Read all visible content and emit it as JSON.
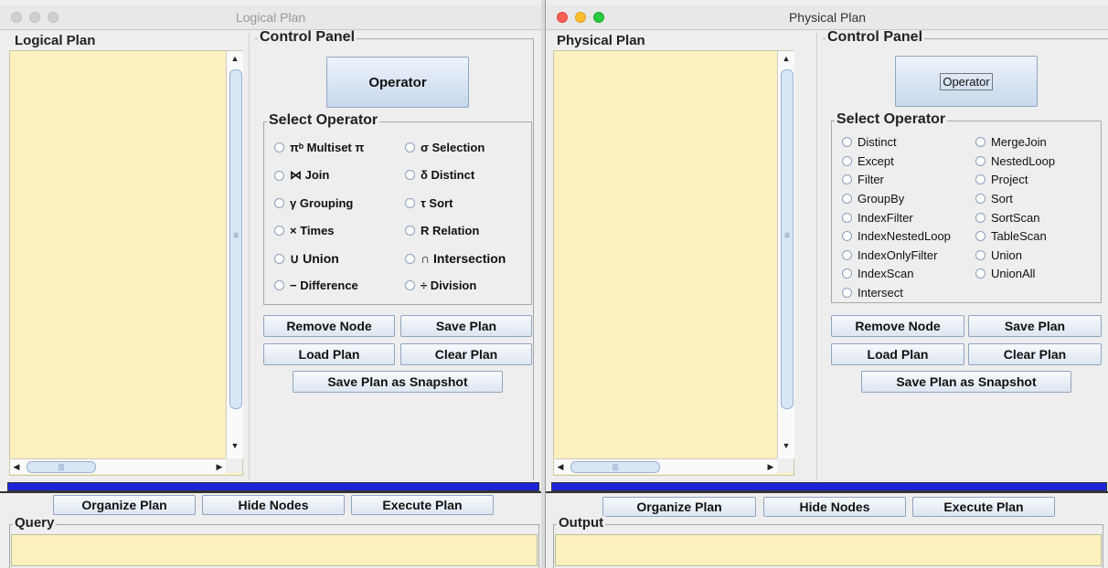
{
  "left": {
    "window_title": "Logical Plan",
    "plan_label": "Logical Plan",
    "control_panel_label": "Control Panel",
    "operator_button": "Operator",
    "select_operator_label": "Select Operator",
    "operators": [
      {
        "label": "πᵇ Multiset π"
      },
      {
        "label": "σ Selection"
      },
      {
        "label": "⋈ Join"
      },
      {
        "label": "δ Distinct"
      },
      {
        "label": "γ Grouping"
      },
      {
        "label": "τ Sort"
      },
      {
        "label": "× Times"
      },
      {
        "label": "R Relation"
      },
      {
        "label": "∪ Union"
      },
      {
        "label": "∩ Intersection"
      },
      {
        "label": "− Difference"
      },
      {
        "label": "÷ Division"
      }
    ],
    "buttons": {
      "remove_node": "Remove Node",
      "save_plan": "Save Plan",
      "load_plan": "Load Plan",
      "clear_plan": "Clear Plan",
      "save_snapshot": "Save Plan as Snapshot",
      "organize_plan": "Organize Plan",
      "hide_nodes": "Hide Nodes",
      "execute_plan": "Execute Plan"
    },
    "bottom_field_label": "Query"
  },
  "right": {
    "window_title": "Physical Plan",
    "plan_label": "Physical Plan",
    "control_panel_label": "Control Panel",
    "operator_button": "Operator",
    "select_operator_label": "Select Operator",
    "operators": [
      {
        "label": "Distinct"
      },
      {
        "label": "MergeJoin"
      },
      {
        "label": "Except"
      },
      {
        "label": "NestedLoop"
      },
      {
        "label": "Filter"
      },
      {
        "label": "Project"
      },
      {
        "label": "GroupBy"
      },
      {
        "label": "Sort"
      },
      {
        "label": "IndexFilter"
      },
      {
        "label": "SortScan"
      },
      {
        "label": "IndexNestedLoop"
      },
      {
        "label": "TableScan"
      },
      {
        "label": "IndexOnlyFilter"
      },
      {
        "label": "Union"
      },
      {
        "label": "IndexScan"
      },
      {
        "label": "UnionAll"
      },
      {
        "label": "Intersect"
      }
    ],
    "buttons": {
      "remove_node": "Remove Node",
      "save_plan": "Save Plan",
      "load_plan": "Load Plan",
      "clear_plan": "Clear Plan",
      "save_snapshot": "Save Plan as Snapshot",
      "organize_plan": "Organize Plan",
      "hide_nodes": "Hide Nodes",
      "execute_plan": "Execute Plan"
    },
    "bottom_field_label": "Output"
  },
  "icons": {
    "scroll_up": "▲",
    "scroll_down": "▼",
    "scroll_left": "◀",
    "scroll_right": "▶",
    "grip_v": "≡",
    "grip_h": "|||"
  },
  "colors": {
    "canvas": "#fdf0bf",
    "progress": "#1d24d8",
    "close": "#fe5f57",
    "minimize": "#febc2e",
    "zoom": "#28c840"
  }
}
